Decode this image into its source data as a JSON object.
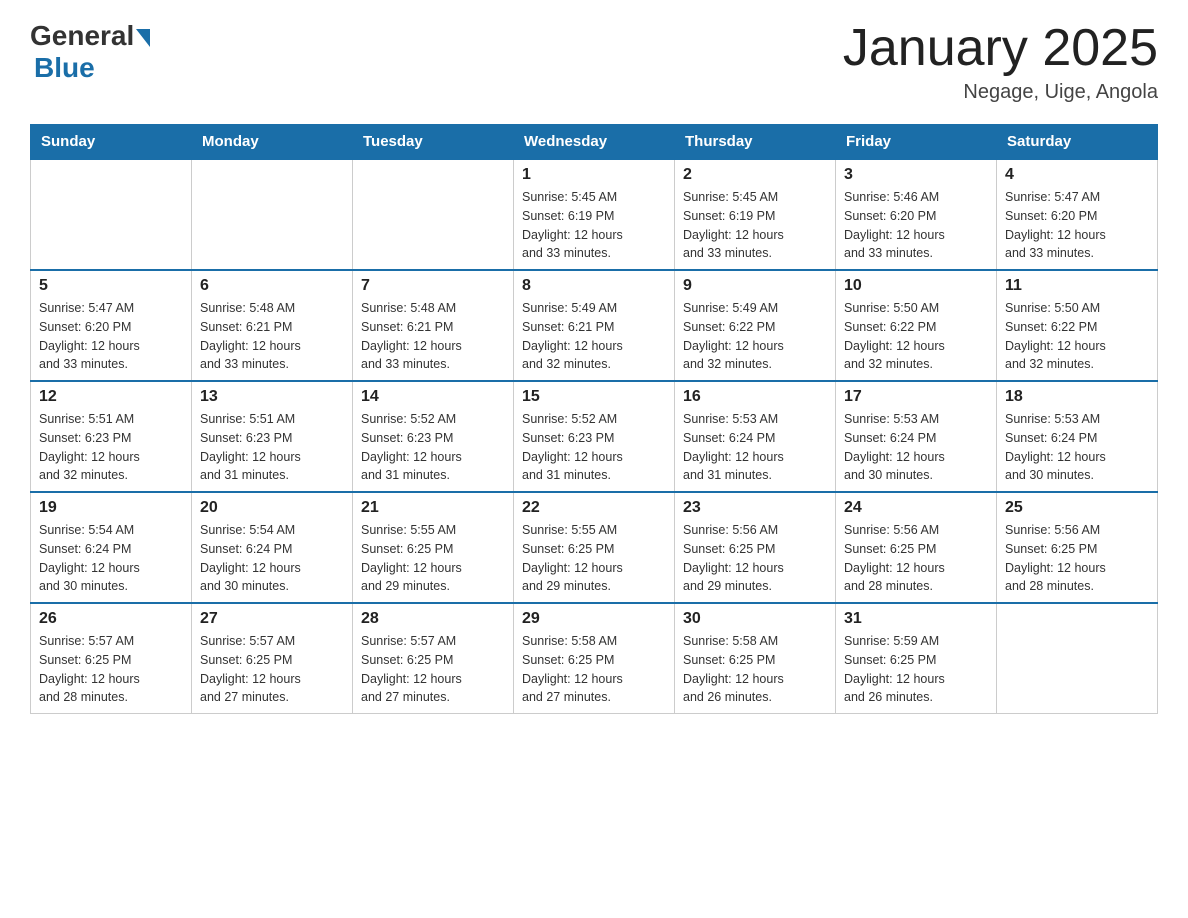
{
  "logo": {
    "general": "General",
    "blue": "Blue"
  },
  "title": "January 2025",
  "subtitle": "Negage, Uige, Angola",
  "days_of_week": [
    "Sunday",
    "Monday",
    "Tuesday",
    "Wednesday",
    "Thursday",
    "Friday",
    "Saturday"
  ],
  "weeks": [
    [
      {
        "day": "",
        "info": ""
      },
      {
        "day": "",
        "info": ""
      },
      {
        "day": "",
        "info": ""
      },
      {
        "day": "1",
        "info": "Sunrise: 5:45 AM\nSunset: 6:19 PM\nDaylight: 12 hours\nand 33 minutes."
      },
      {
        "day": "2",
        "info": "Sunrise: 5:45 AM\nSunset: 6:19 PM\nDaylight: 12 hours\nand 33 minutes."
      },
      {
        "day": "3",
        "info": "Sunrise: 5:46 AM\nSunset: 6:20 PM\nDaylight: 12 hours\nand 33 minutes."
      },
      {
        "day": "4",
        "info": "Sunrise: 5:47 AM\nSunset: 6:20 PM\nDaylight: 12 hours\nand 33 minutes."
      }
    ],
    [
      {
        "day": "5",
        "info": "Sunrise: 5:47 AM\nSunset: 6:20 PM\nDaylight: 12 hours\nand 33 minutes."
      },
      {
        "day": "6",
        "info": "Sunrise: 5:48 AM\nSunset: 6:21 PM\nDaylight: 12 hours\nand 33 minutes."
      },
      {
        "day": "7",
        "info": "Sunrise: 5:48 AM\nSunset: 6:21 PM\nDaylight: 12 hours\nand 33 minutes."
      },
      {
        "day": "8",
        "info": "Sunrise: 5:49 AM\nSunset: 6:21 PM\nDaylight: 12 hours\nand 32 minutes."
      },
      {
        "day": "9",
        "info": "Sunrise: 5:49 AM\nSunset: 6:22 PM\nDaylight: 12 hours\nand 32 minutes."
      },
      {
        "day": "10",
        "info": "Sunrise: 5:50 AM\nSunset: 6:22 PM\nDaylight: 12 hours\nand 32 minutes."
      },
      {
        "day": "11",
        "info": "Sunrise: 5:50 AM\nSunset: 6:22 PM\nDaylight: 12 hours\nand 32 minutes."
      }
    ],
    [
      {
        "day": "12",
        "info": "Sunrise: 5:51 AM\nSunset: 6:23 PM\nDaylight: 12 hours\nand 32 minutes."
      },
      {
        "day": "13",
        "info": "Sunrise: 5:51 AM\nSunset: 6:23 PM\nDaylight: 12 hours\nand 31 minutes."
      },
      {
        "day": "14",
        "info": "Sunrise: 5:52 AM\nSunset: 6:23 PM\nDaylight: 12 hours\nand 31 minutes."
      },
      {
        "day": "15",
        "info": "Sunrise: 5:52 AM\nSunset: 6:23 PM\nDaylight: 12 hours\nand 31 minutes."
      },
      {
        "day": "16",
        "info": "Sunrise: 5:53 AM\nSunset: 6:24 PM\nDaylight: 12 hours\nand 31 minutes."
      },
      {
        "day": "17",
        "info": "Sunrise: 5:53 AM\nSunset: 6:24 PM\nDaylight: 12 hours\nand 30 minutes."
      },
      {
        "day": "18",
        "info": "Sunrise: 5:53 AM\nSunset: 6:24 PM\nDaylight: 12 hours\nand 30 minutes."
      }
    ],
    [
      {
        "day": "19",
        "info": "Sunrise: 5:54 AM\nSunset: 6:24 PM\nDaylight: 12 hours\nand 30 minutes."
      },
      {
        "day": "20",
        "info": "Sunrise: 5:54 AM\nSunset: 6:24 PM\nDaylight: 12 hours\nand 30 minutes."
      },
      {
        "day": "21",
        "info": "Sunrise: 5:55 AM\nSunset: 6:25 PM\nDaylight: 12 hours\nand 29 minutes."
      },
      {
        "day": "22",
        "info": "Sunrise: 5:55 AM\nSunset: 6:25 PM\nDaylight: 12 hours\nand 29 minutes."
      },
      {
        "day": "23",
        "info": "Sunrise: 5:56 AM\nSunset: 6:25 PM\nDaylight: 12 hours\nand 29 minutes."
      },
      {
        "day": "24",
        "info": "Sunrise: 5:56 AM\nSunset: 6:25 PM\nDaylight: 12 hours\nand 28 minutes."
      },
      {
        "day": "25",
        "info": "Sunrise: 5:56 AM\nSunset: 6:25 PM\nDaylight: 12 hours\nand 28 minutes."
      }
    ],
    [
      {
        "day": "26",
        "info": "Sunrise: 5:57 AM\nSunset: 6:25 PM\nDaylight: 12 hours\nand 28 minutes."
      },
      {
        "day": "27",
        "info": "Sunrise: 5:57 AM\nSunset: 6:25 PM\nDaylight: 12 hours\nand 27 minutes."
      },
      {
        "day": "28",
        "info": "Sunrise: 5:57 AM\nSunset: 6:25 PM\nDaylight: 12 hours\nand 27 minutes."
      },
      {
        "day": "29",
        "info": "Sunrise: 5:58 AM\nSunset: 6:25 PM\nDaylight: 12 hours\nand 27 minutes."
      },
      {
        "day": "30",
        "info": "Sunrise: 5:58 AM\nSunset: 6:25 PM\nDaylight: 12 hours\nand 26 minutes."
      },
      {
        "day": "31",
        "info": "Sunrise: 5:59 AM\nSunset: 6:25 PM\nDaylight: 12 hours\nand 26 minutes."
      },
      {
        "day": "",
        "info": ""
      }
    ]
  ]
}
